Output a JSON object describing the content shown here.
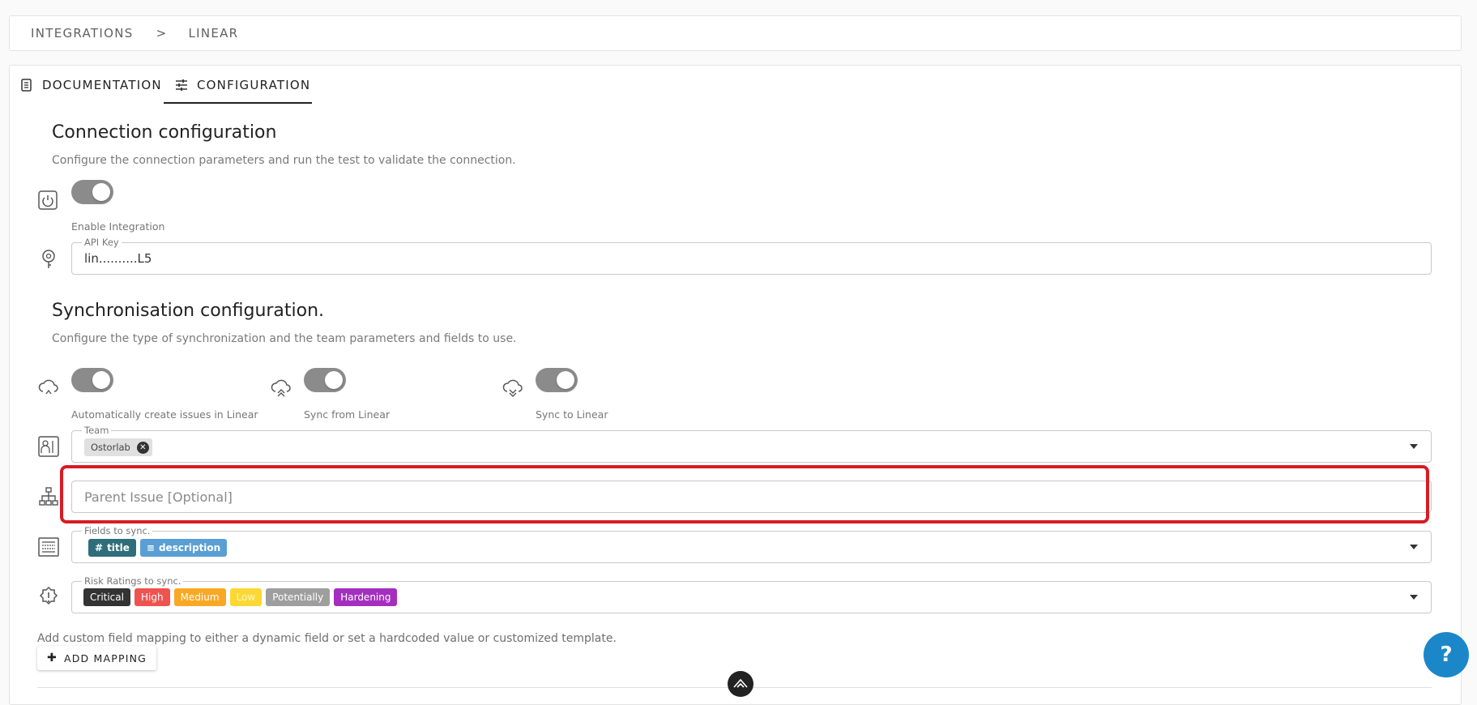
{
  "breadcrumb": {
    "root": "INTEGRATIONS",
    "separator": ">",
    "current": "LINEAR"
  },
  "tabs": [
    {
      "label": "DOCUMENTATION",
      "icon": "document-icon",
      "active": false
    },
    {
      "label": "CONFIGURATION",
      "icon": "sliders-icon",
      "active": true
    }
  ],
  "connection": {
    "title": "Connection configuration",
    "subtitle": "Configure the connection parameters and run the test to validate the connection.",
    "enable_label": "Enable Integration",
    "enabled": true,
    "api_key_legend": "API Key",
    "api_key_value": "lin..........L5"
  },
  "sync": {
    "title": "Synchronisation configuration.",
    "subtitle": "Configure the type of synchronization and the team parameters and fields to use.",
    "toggles": [
      {
        "label": "Automatically create issues in Linear",
        "on": true,
        "icon": "cloud-sync-icon"
      },
      {
        "label": "Sync from Linear",
        "on": true,
        "icon": "cloud-upload-icon"
      },
      {
        "label": "Sync to Linear",
        "on": true,
        "icon": "cloud-download-icon"
      }
    ],
    "team_legend": "Team",
    "team_chip": "Ostorlab",
    "parent_placeholder": "Parent Issue [Optional]",
    "fields_legend": "Fields to sync.",
    "fields": [
      {
        "label": "title",
        "prefix": "#",
        "color": "#2e6e7a"
      },
      {
        "label": "description",
        "prefix": "≡",
        "color": "#5a9fd4"
      }
    ],
    "risk_legend": "Risk Ratings to sync.",
    "risks": [
      {
        "label": "Critical",
        "color": "#333333"
      },
      {
        "label": "High",
        "color": "#ef5350"
      },
      {
        "label": "Medium",
        "color": "#f9a825"
      },
      {
        "label": "Low",
        "color": "#fdd835"
      },
      {
        "label": "Potentially",
        "color": "#9e9e9e"
      },
      {
        "label": "Hardening",
        "color": "#a42fbf"
      }
    ],
    "custom_mapping_text": "Add custom field mapping to either a dynamic field or set a hardcoded value or customized template.",
    "add_mapping_label": "ADD MAPPING"
  },
  "help": {
    "label": "?"
  },
  "colors": {
    "accent": "#1b87c9",
    "highlight": "#d81b24",
    "toggle": "#8b8b8b"
  }
}
